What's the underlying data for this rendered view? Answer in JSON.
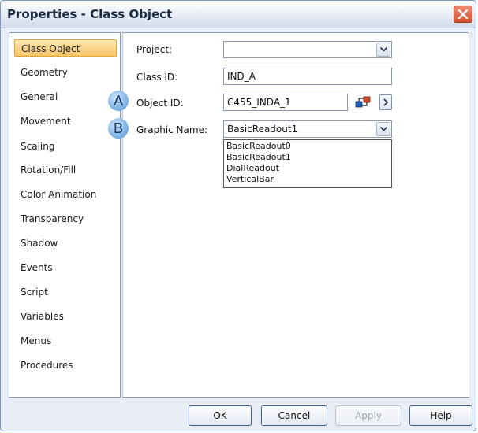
{
  "window": {
    "title": "Properties - Class Object"
  },
  "sidebar": {
    "items": [
      {
        "label": "Class Object",
        "active": true
      },
      {
        "label": "Geometry"
      },
      {
        "label": "General"
      },
      {
        "label": "Movement"
      },
      {
        "label": "Scaling"
      },
      {
        "label": "Rotation/Fill"
      },
      {
        "label": "Color Animation"
      },
      {
        "label": "Transparency"
      },
      {
        "label": "Shadow"
      },
      {
        "label": "Events"
      },
      {
        "label": "Script"
      },
      {
        "label": "Variables"
      },
      {
        "label": "Menus"
      },
      {
        "label": "Procedures"
      }
    ]
  },
  "form": {
    "project_label": "Project:",
    "project_value": "",
    "class_id_label": "Class ID:",
    "class_id_value": "IND_A",
    "object_id_label": "Object ID:",
    "object_id_value": "C455_INDA_1",
    "graphic_name_label": "Graphic Name:",
    "graphic_name_value": "BasicReadout1",
    "graphic_options": [
      "BasicReadout0",
      "BasicReadout1",
      "DialReadout",
      "VerticalBar"
    ]
  },
  "callouts": {
    "a": "A",
    "b": "B"
  },
  "buttons": {
    "ok": "OK",
    "cancel": "Cancel",
    "apply": "Apply",
    "help": "Help"
  },
  "colors": {
    "accent_active": "#f7c565",
    "title_bar": "#e3e9f3",
    "close": "#d4502e"
  }
}
